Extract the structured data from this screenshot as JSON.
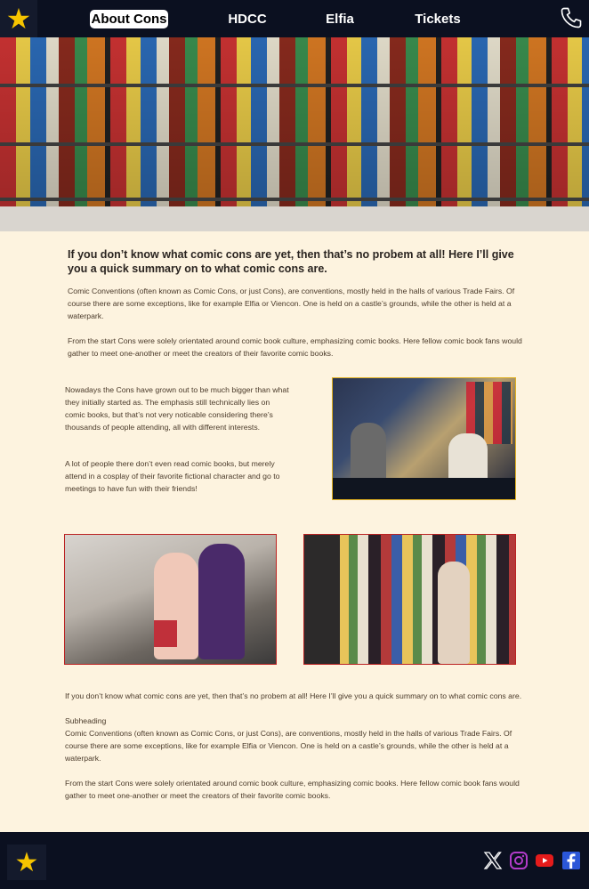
{
  "nav": {
    "items": [
      {
        "label": "About Cons"
      },
      {
        "label": "HDCC"
      },
      {
        "label": "Elfia"
      },
      {
        "label": "Tickets"
      }
    ]
  },
  "intro": {
    "lead": "If you don’t know what comic cons are yet, then that’s no probem at all! Here I’ll give you a quick summary on to what comic cons are.",
    "p1": "Comic Conventions (often known as Comic Cons, or just Cons), are conventions, mostly held in the halls of various Trade Fairs. Of course there are some exceptions, like for example Elfia or Viencon. One is held on a castle’s grounds, while the other is held at a waterpark.",
    "p2": "From the start Cons were solely orientated around comic book culture, emphasizing comic books. Here fellow comic book fans would gather to meet one-another or meet the creators of their favorite comic books."
  },
  "middle": {
    "p1": "Nowadays the Cons have grown out to be much bigger than what they initially started as. The emphasis still technically lies on comic books, but that’s not very noticable considering there’s thousands of people attending, all with different interests.",
    "p2": "A lot of people there don’t even read comic books, but merely attend in a cosplay of their favorite fictional character and go to meetings to have fun with their friends!"
  },
  "bottom": {
    "line1": "If you don’t know what comic cons are yet, then that’s no probem at all! Here I’ll give you a quick summary on to what comic cons are.",
    "subheading": "Subheading",
    "p1": "Comic Conventions (often known as Comic Cons, or just Cons), are conventions, mostly held in the halls of various Trade Fairs. Of course there are some exceptions, like for example Elfia or Viencon. One is held on a castle’s grounds, while the other is held at a waterpark.",
    "p2": "From the start Cons were solely orientated around comic book culture, emphasizing comic books. Here fellow comic book fans would gather to meet one-another or meet the creators of their favorite comic books."
  },
  "colors": {
    "nav_bg": "#0b1020",
    "page_bg": "#fdf3df",
    "photo_border_red": "#b22222",
    "photo_border_gold": "#e0b020"
  },
  "icons": {
    "logo": "star-mascot-icon",
    "phone": "phone-icon",
    "social": [
      "x-icon",
      "instagram-icon",
      "youtube-icon",
      "facebook-icon"
    ]
  }
}
